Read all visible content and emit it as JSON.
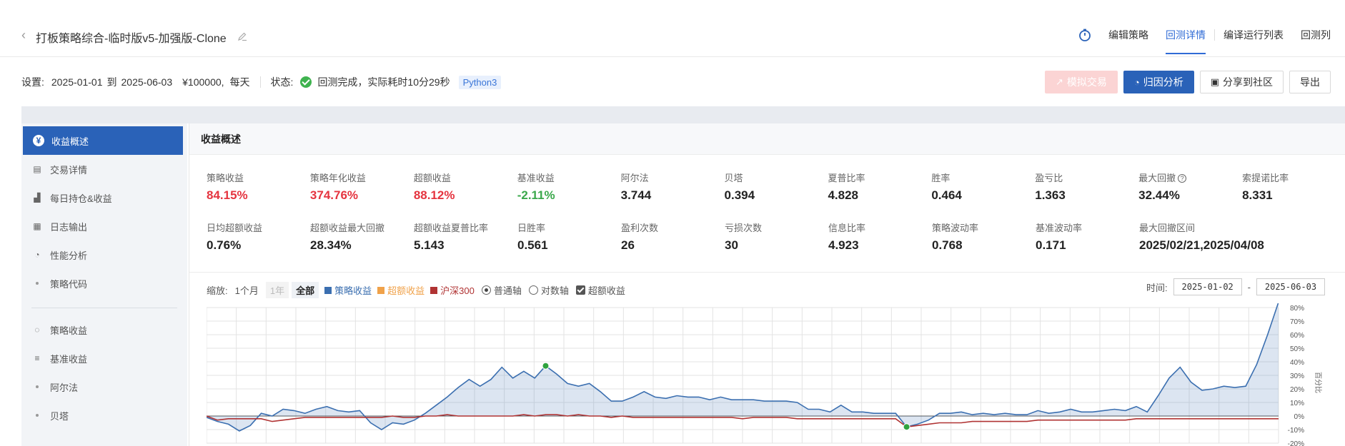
{
  "header": {
    "title": "打板策略综合-临时版v5-加强版-Clone",
    "nav": [
      {
        "label": "编辑策略",
        "active": false
      },
      {
        "label": "回测详情",
        "active": true
      },
      {
        "label": "编译运行列表",
        "active": false
      },
      {
        "label": "回测列",
        "active": false
      }
    ]
  },
  "settings": {
    "prefix": "设置:",
    "start": "2025-01-01",
    "to": "到",
    "end": "2025-06-03",
    "capital": "¥100000,",
    "freq": "每天",
    "status_label": "状态:",
    "status_text": "回测完成，实际耗时10分29秒",
    "lang": "Python3"
  },
  "buttons": {
    "sim": "模拟交易",
    "attr": "归因分析",
    "share": "分享到社区",
    "export": "导出"
  },
  "sidebar": {
    "items": [
      {
        "label": "收益概述",
        "icon": "yen-icon",
        "glyph": "¥",
        "active": true
      },
      {
        "label": "交易详情",
        "icon": "document-icon",
        "glyph": "▤"
      },
      {
        "label": "每日持仓&收益",
        "icon": "bar-chart-icon",
        "glyph": "▟"
      },
      {
        "label": "日志输出",
        "icon": "calendar-icon",
        "glyph": "▦"
      },
      {
        "label": "性能分析",
        "icon": "pie-chart-icon",
        "glyph": "◔"
      },
      {
        "label": "策略代码",
        "icon": "dot",
        "glyph": ""
      }
    ],
    "items2": [
      {
        "label": "策略收益",
        "icon": "bulb-icon",
        "glyph": "◌"
      },
      {
        "label": "基准收益",
        "icon": "database-icon",
        "glyph": "≡"
      },
      {
        "label": "阿尔法",
        "icon": "dot",
        "glyph": ""
      },
      {
        "label": "贝塔",
        "icon": "dot",
        "glyph": ""
      }
    ]
  },
  "panel": {
    "title": "收益概述",
    "metrics_row1": [
      {
        "label": "策略收益",
        "value": "84.15%",
        "tone": "red"
      },
      {
        "label": "策略年化收益",
        "value": "374.76%",
        "tone": "red"
      },
      {
        "label": "超额收益",
        "value": "88.12%",
        "tone": "red"
      },
      {
        "label": "基准收益",
        "value": "-2.11%",
        "tone": "green"
      },
      {
        "label": "阿尔法",
        "value": "3.744",
        "tone": ""
      },
      {
        "label": "贝塔",
        "value": "0.394",
        "tone": ""
      },
      {
        "label": "夏普比率",
        "value": "4.828",
        "tone": ""
      },
      {
        "label": "胜率",
        "value": "0.464",
        "tone": ""
      },
      {
        "label": "盈亏比",
        "value": "1.363",
        "tone": ""
      },
      {
        "label": "最大回撤",
        "value": "32.44%",
        "tone": "",
        "help": "?"
      },
      {
        "label": "索提诺比率",
        "value": "8.331",
        "tone": ""
      }
    ],
    "metrics_row2": [
      {
        "label": "日均超额收益",
        "value": "0.76%"
      },
      {
        "label": "超额收益最大回撤",
        "value": "28.34%"
      },
      {
        "label": "超额收益夏普比率",
        "value": "5.143"
      },
      {
        "label": "日胜率",
        "value": "0.561"
      },
      {
        "label": "盈利次数",
        "value": "26"
      },
      {
        "label": "亏损次数",
        "value": "30"
      },
      {
        "label": "信息比率",
        "value": "4.923"
      },
      {
        "label": "策略波动率",
        "value": "0.768"
      },
      {
        "label": "基准波动率",
        "value": "0.171"
      },
      {
        "label": "最大回撤区间",
        "value": "2025/02/21,2025/04/08",
        "wide": true
      }
    ]
  },
  "controls": {
    "zoom": "缩放:",
    "r1m": "1个月",
    "r1y": "1年",
    "rall": "全部",
    "leg_strategy": "策略收益",
    "leg_excess": "超额收益",
    "leg_bench": "沪深300",
    "axis_normal": "普通轴",
    "axis_log": "对数轴",
    "show_excess": "超额收益",
    "time_label": "时间:",
    "date_from": "2025-01-02",
    "date_sep": "-",
    "date_to": "2025-06-03",
    "colors": {
      "strategy": "#3b6fb0",
      "excess": "#f0a24a",
      "bench": "#b03333"
    }
  },
  "chart_data": {
    "type": "line",
    "ylim": [
      -20,
      80
    ],
    "yticks": [
      "80%",
      "70%",
      "60%",
      "50%",
      "40%",
      "30%",
      "20%",
      "10%",
      "0%",
      "-10%",
      "-20%"
    ],
    "yaxis_side_label": "百分比",
    "series": [
      {
        "name": "策略收益",
        "values": [
          -1,
          -4,
          -6,
          -11,
          -7,
          2,
          0,
          5,
          4,
          2,
          5,
          7,
          4,
          3,
          4,
          -5,
          -10,
          -5,
          -6,
          -3,
          2,
          8,
          14,
          21,
          27,
          22,
          27,
          36,
          28,
          33,
          28,
          37,
          31,
          24,
          22,
          24,
          18,
          11,
          11,
          14,
          18,
          14,
          13,
          15,
          14,
          14,
          12,
          14,
          12,
          12,
          12,
          11,
          11,
          11,
          10,
          5,
          5,
          3,
          8,
          3,
          3,
          2,
          2,
          2,
          -8,
          -6,
          -3,
          2,
          2,
          3,
          1,
          2,
          1,
          2,
          1,
          1,
          4,
          2,
          3,
          5,
          3,
          3,
          4,
          5,
          4,
          7,
          3,
          15,
          28,
          36,
          25,
          19,
          20,
          22,
          21,
          22,
          38,
          60,
          84
        ]
      },
      {
        "name": "沪深300",
        "values": [
          0,
          -3,
          -2,
          -2,
          -2,
          -2,
          -4,
          -3,
          -2,
          -1,
          -1,
          -1,
          -1,
          -1,
          -1,
          -1,
          -1,
          0,
          -1,
          -1,
          0,
          0,
          1,
          0,
          0,
          0,
          0,
          0,
          0,
          1,
          0,
          1,
          1,
          0,
          1,
          0,
          0,
          -1,
          0,
          -1,
          -1,
          -1,
          -1,
          -1,
          -1,
          -1,
          -1,
          -1,
          -1,
          -2,
          -1,
          -1,
          -1,
          -1,
          -2,
          -2,
          -2,
          -2,
          -2,
          -2,
          -2,
          -2,
          -2,
          -2,
          -8,
          -7,
          -6,
          -5,
          -5,
          -5,
          -4,
          -4,
          -4,
          -4,
          -4,
          -4,
          -3,
          -3,
          -3,
          -3,
          -3,
          -3,
          -3,
          -3,
          -3,
          -2,
          -2,
          -2,
          -2,
          -2,
          -2,
          -2,
          -2,
          -2,
          -2,
          -2,
          -2,
          -2,
          -2
        ]
      }
    ],
    "markers": [
      {
        "index": 31,
        "series": 0
      },
      {
        "index": 64,
        "series": 0
      }
    ]
  }
}
